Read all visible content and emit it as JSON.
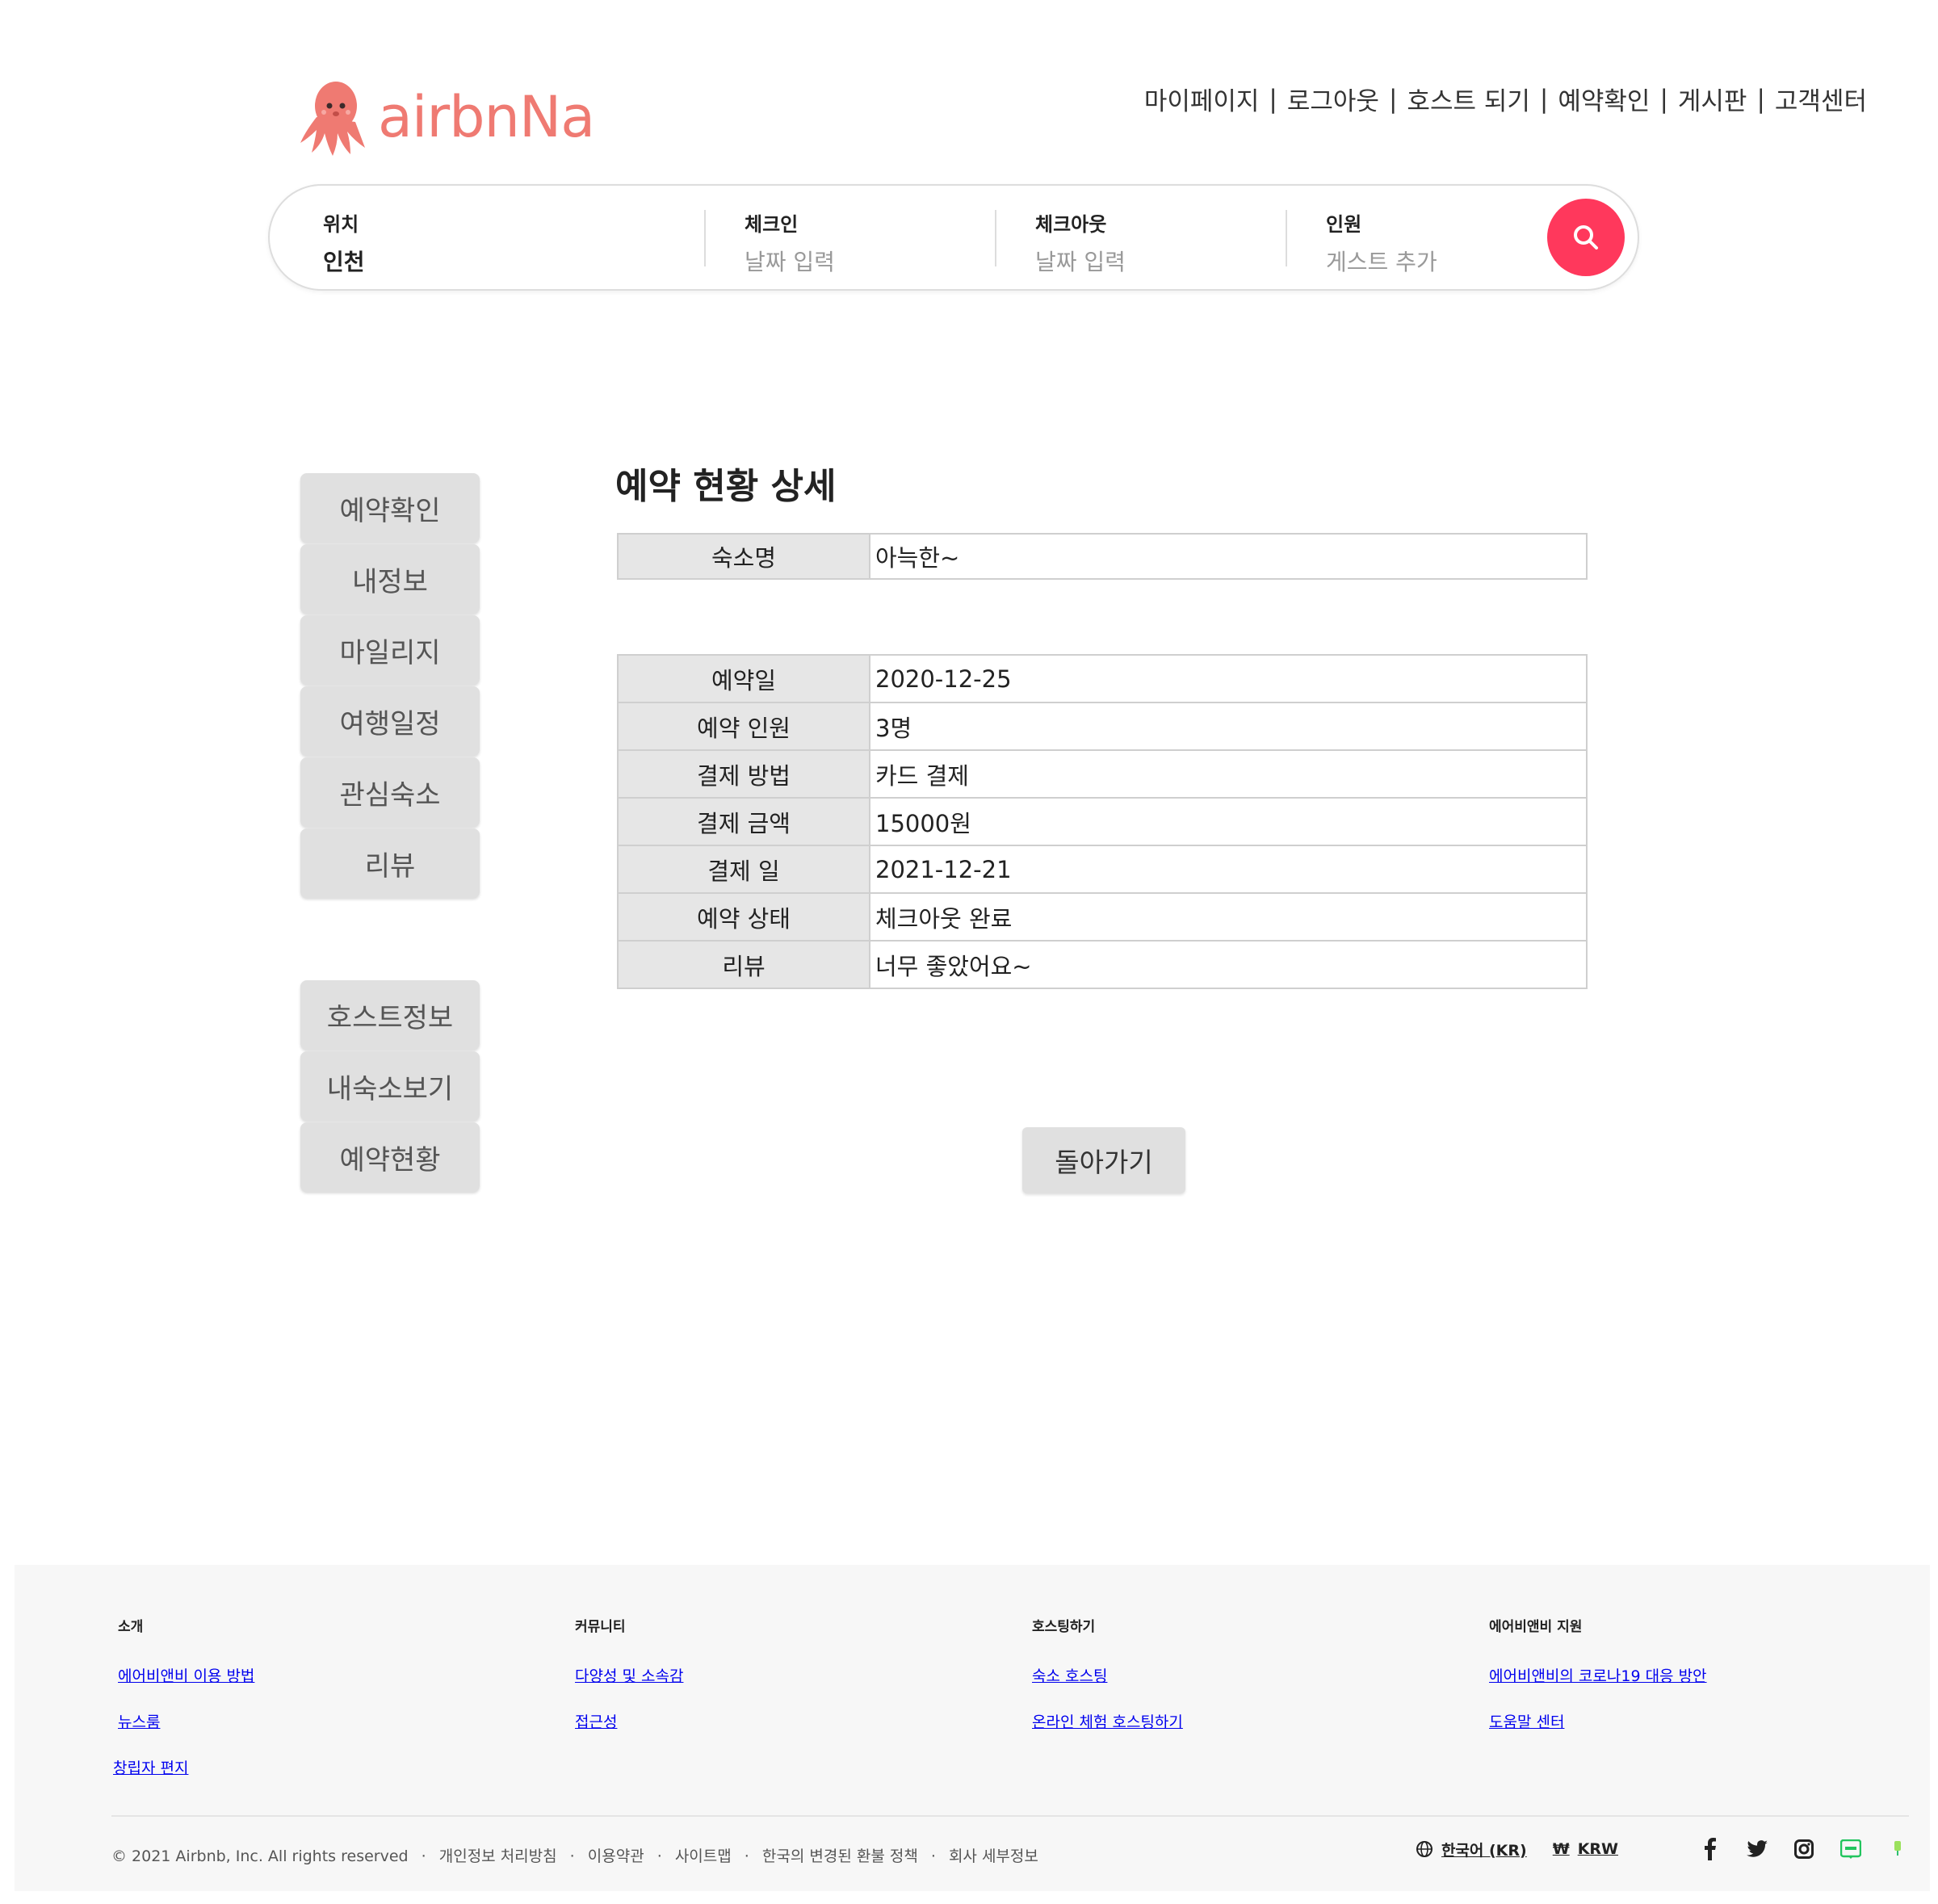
{
  "brand": {
    "name": "airbnNa",
    "color": "#ef7a72"
  },
  "topnav": [
    "마이페이지",
    "로그아웃",
    "호스트 되기",
    "예약확인",
    "게시판",
    "고객센터"
  ],
  "search": {
    "location": {
      "label": "위치",
      "value": "인천"
    },
    "checkin": {
      "label": "체크인",
      "placeholder": "날짜 입력"
    },
    "checkout": {
      "label": "체크아웃",
      "placeholder": "날짜 입력"
    },
    "guests": {
      "label": "인원",
      "placeholder": "게스트 추가"
    },
    "button_icon": "search-icon",
    "accent": "#ff385c"
  },
  "sidebar": {
    "guest_menu": [
      "예약확인",
      "내정보",
      "마일리지",
      "여행일정",
      "관심숙소",
      "리뷰"
    ],
    "host_menu": [
      "호스트정보",
      "내숙소보기",
      "예약현황"
    ]
  },
  "main": {
    "title": "예약 현황 상세",
    "accommodation": {
      "label": "숙소명",
      "value": "아늑한~"
    },
    "details": [
      {
        "label": "예약일",
        "value": "2020-12-25"
      },
      {
        "label": "예약 인원",
        "value": "3명"
      },
      {
        "label": "결제 방법",
        "value": "카드 결제"
      },
      {
        "label": "결제 금액",
        "value": "15000원"
      },
      {
        "label": "결제 일",
        "value": "2021-12-21"
      },
      {
        "label": "예약 상태",
        "value": "체크아웃 완료"
      },
      {
        "label": "리뷰",
        "value": "너무 좋았어요~"
      }
    ],
    "back_label": "돌아가기"
  },
  "footer": {
    "columns": [
      {
        "heading": "소개",
        "links": [
          "에어비앤비 이용 방법",
          "뉴스룸",
          "창립자 편지"
        ]
      },
      {
        "heading": "커뮤니티",
        "links": [
          "다양성 및 소속감",
          "접근성"
        ]
      },
      {
        "heading": "호스팅하기",
        "links": [
          "숙소 호스팅",
          "온라인 체험 호스팅하기"
        ]
      },
      {
        "heading": "에어비앤비 지원",
        "links": [
          "에어비앤비의 코로나19 대응 방안",
          "도움말 센터"
        ]
      }
    ],
    "copyright": "© 2021 Airbnb, Inc. All rights reserved",
    "legal_links": [
      "개인정보 처리방침",
      "이용약관",
      "사이트맵",
      "한국의 변경된 환불 정책",
      "회사 세부정보"
    ],
    "language": "한국어 (KR)",
    "currency_symbol": "₩",
    "currency": "KRW",
    "social": [
      "facebook-icon",
      "twitter-icon",
      "instagram-icon",
      "naver-blog-icon",
      "naver-post-icon"
    ]
  }
}
